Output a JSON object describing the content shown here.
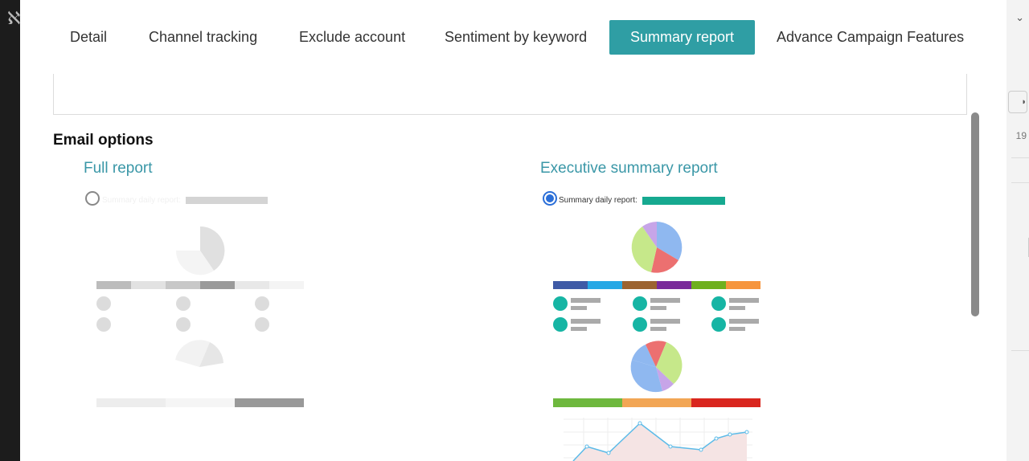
{
  "tabs": [
    {
      "label": "Detail"
    },
    {
      "label": "Channel tracking"
    },
    {
      "label": "Exclude account"
    },
    {
      "label": "Sentiment by keyword"
    },
    {
      "label": "Summary report",
      "active": true
    },
    {
      "label": "Advance Campaign Features"
    }
  ],
  "section_title": "Email options",
  "options": {
    "full": {
      "title": "Full report",
      "radio_label": "Summary daily report:",
      "selected": false
    },
    "executive": {
      "title": "Executive summary report",
      "radio_label": "Summary daily report:",
      "selected": true
    }
  },
  "background": {
    "page_number": "19"
  },
  "colors": {
    "accent": "#2f9ea4",
    "title_color": "#3a97a7",
    "teal_dot": "#16b5a4"
  }
}
